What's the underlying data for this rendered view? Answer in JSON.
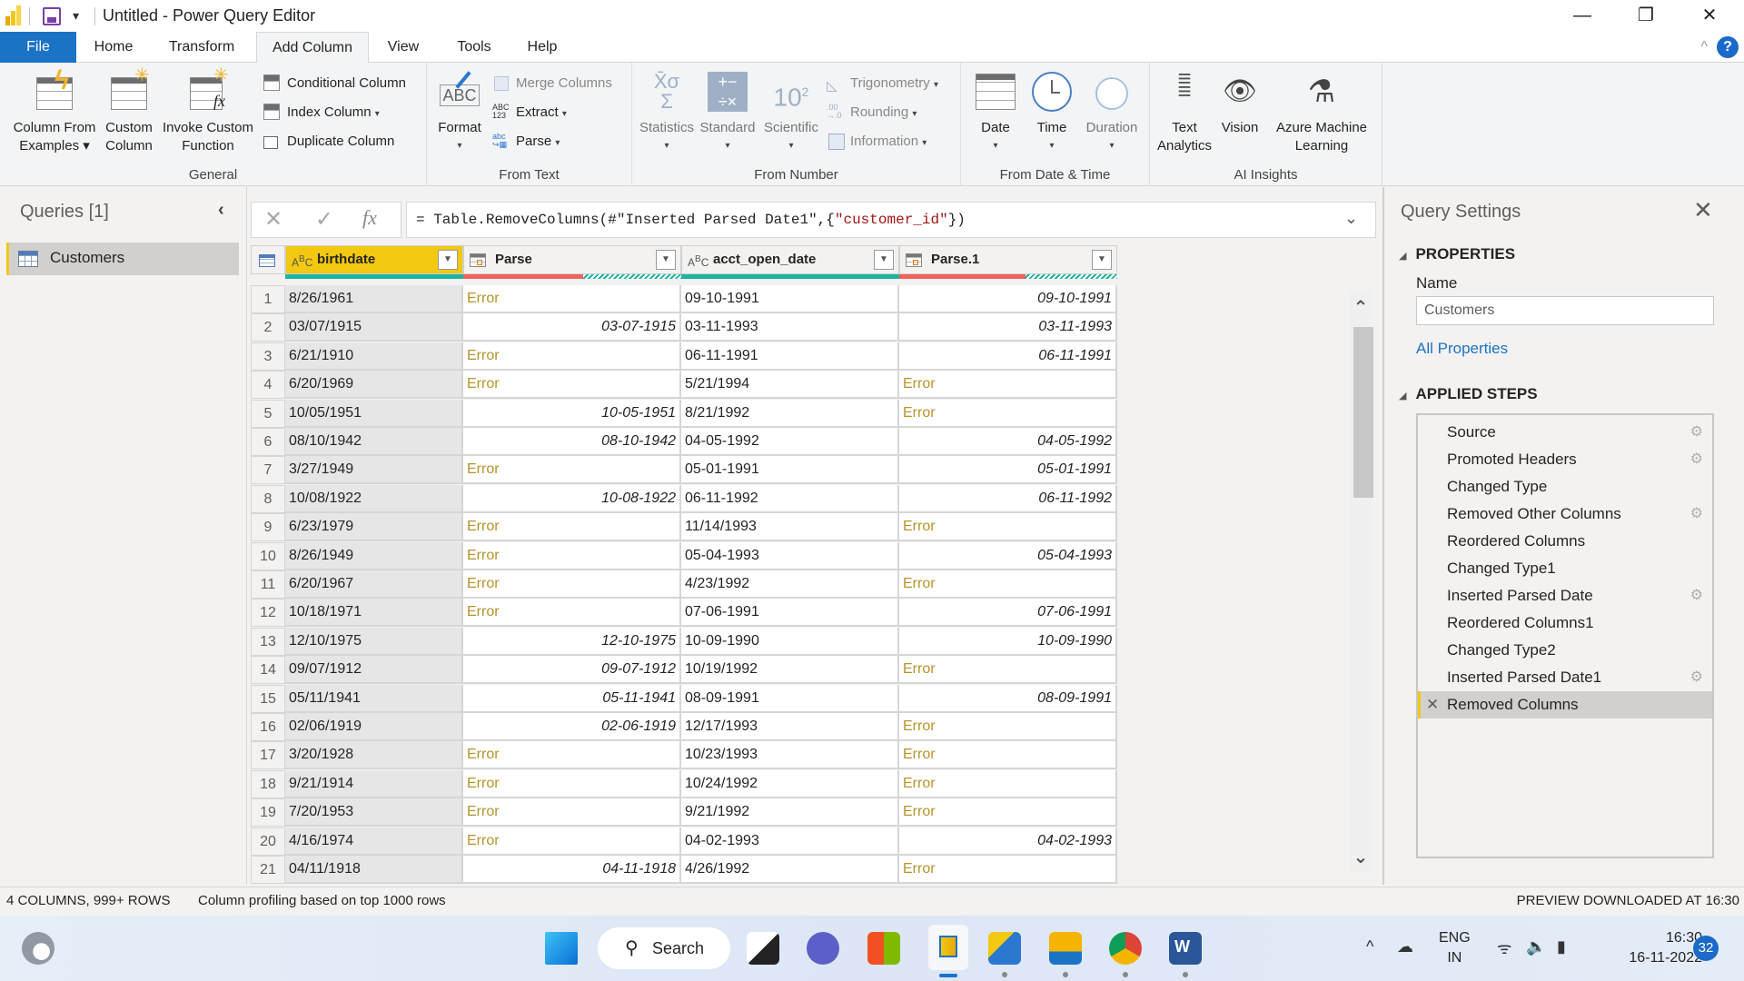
{
  "window": {
    "title": "Untitled - Power Query Editor",
    "qat_dropdown": "▾",
    "minimize": "—",
    "restore": "❐",
    "close": "✕"
  },
  "ribbon_tabs": [
    {
      "label": "File"
    },
    {
      "label": "Home"
    },
    {
      "label": "Transform"
    },
    {
      "label": "Add Column",
      "active": true
    },
    {
      "label": "View"
    },
    {
      "label": "Tools"
    },
    {
      "label": "Help"
    }
  ],
  "ribbon_controls": {
    "collapse": "^",
    "help": "?"
  },
  "ribbon": {
    "general": {
      "label": "General",
      "column_from_examples": [
        "Column From",
        "Examples ▾"
      ],
      "custom_column": [
        "Custom",
        "Column"
      ],
      "invoke_custom_function": [
        "Invoke Custom",
        "Function"
      ],
      "conditional_column": "Conditional Column",
      "index_column": "Index Column",
      "duplicate_column": "Duplicate Column"
    },
    "from_text": {
      "label": "From Text",
      "format": "Format",
      "merge_columns": "Merge Columns",
      "extract": "Extract",
      "parse": "Parse"
    },
    "from_number": {
      "label": "From Number",
      "statistics": "Statistics",
      "standard": "Standard",
      "scientific": "Scientific",
      "trigonometry": "Trigonometry",
      "rounding": "Rounding",
      "information": "Information"
    },
    "from_date_time": {
      "label": "From Date & Time",
      "date": "Date",
      "time": "Time",
      "duration": "Duration"
    },
    "ai_insights": {
      "label": "AI Insights",
      "text_analytics": [
        "Text",
        "Analytics"
      ],
      "vision": "Vision",
      "azure_ml": [
        "Azure Machine",
        "Learning"
      ]
    },
    "caret": "▾"
  },
  "queries": {
    "title": "Queries [1]",
    "collapse": "‹",
    "items": [
      {
        "label": "Customers",
        "selected": true
      }
    ]
  },
  "formula_bar": {
    "cancel": "✕",
    "commit": "✓",
    "fx": "fx",
    "prefix": "= Table.RemoveColumns(#\"Inserted Parsed Date1\",{",
    "string_literal": "\"customer_id\"",
    "suffix": "})",
    "expand": "⌄"
  },
  "grid": {
    "columns": [
      {
        "name": "birthdate",
        "type": "text",
        "type_icon": "ABC",
        "selected": true,
        "quality": {
          "valid": 1.0,
          "error": 0.0
        }
      },
      {
        "name": "Parse",
        "type": "date",
        "quality": {
          "valid": 0.0,
          "error": 0.55
        }
      },
      {
        "name": "acct_open_date",
        "type": "text",
        "type_icon": "ABC",
        "quality": {
          "valid": 1.0,
          "error": 0.0
        }
      },
      {
        "name": "Parse.1",
        "type": "date",
        "quality": {
          "valid": 0.0,
          "error": 0.58
        }
      }
    ],
    "rows": [
      [
        "8/26/1961",
        "Error",
        "09-10-1991",
        "09-10-1991"
      ],
      [
        "03/07/1915",
        "03-07-1915",
        "03-11-1993",
        "03-11-1993"
      ],
      [
        "6/21/1910",
        "Error",
        "06-11-1991",
        "06-11-1991"
      ],
      [
        "6/20/1969",
        "Error",
        "5/21/1994",
        "Error"
      ],
      [
        "10/05/1951",
        "10-05-1951",
        "8/21/1992",
        "Error"
      ],
      [
        "08/10/1942",
        "08-10-1942",
        "04-05-1992",
        "04-05-1992"
      ],
      [
        "3/27/1949",
        "Error",
        "05-01-1991",
        "05-01-1991"
      ],
      [
        "10/08/1922",
        "10-08-1922",
        "06-11-1992",
        "06-11-1992"
      ],
      [
        "6/23/1979",
        "Error",
        "11/14/1993",
        "Error"
      ],
      [
        "8/26/1949",
        "Error",
        "05-04-1993",
        "05-04-1993"
      ],
      [
        "6/20/1967",
        "Error",
        "4/23/1992",
        "Error"
      ],
      [
        "10/18/1971",
        "Error",
        "07-06-1991",
        "07-06-1991"
      ],
      [
        "12/10/1975",
        "12-10-1975",
        "10-09-1990",
        "10-09-1990"
      ],
      [
        "09/07/1912",
        "09-07-1912",
        "10/19/1992",
        "Error"
      ],
      [
        "05/11/1941",
        "05-11-1941",
        "08-09-1991",
        "08-09-1991"
      ],
      [
        "02/06/1919",
        "02-06-1919",
        "12/17/1993",
        "Error"
      ],
      [
        "3/20/1928",
        "Error",
        "10/23/1993",
        "Error"
      ],
      [
        "9/21/1914",
        "Error",
        "10/24/1992",
        "Error"
      ],
      [
        "7/20/1953",
        "Error",
        "9/21/1992",
        "Error"
      ],
      [
        "4/16/1974",
        "Error",
        "04-02-1993",
        "04-02-1993"
      ],
      [
        "04/11/1918",
        "04-11-1918",
        "4/26/1992",
        "Error"
      ]
    ],
    "scroll_up": "⌃",
    "scroll_down": "⌄"
  },
  "query_settings": {
    "title": "Query Settings",
    "close": "✕",
    "properties_header": "PROPERTIES",
    "name_label": "Name",
    "name_value": "Customers",
    "all_properties": "All Properties",
    "applied_steps_header": "APPLIED STEPS",
    "steps": [
      {
        "label": "Source",
        "gear": true
      },
      {
        "label": "Promoted Headers",
        "gear": true
      },
      {
        "label": "Changed Type",
        "gear": false
      },
      {
        "label": "Removed Other Columns",
        "gear": true
      },
      {
        "label": "Reordered Columns",
        "gear": false
      },
      {
        "label": "Changed Type1",
        "gear": false
      },
      {
        "label": "Inserted Parsed Date",
        "gear": true
      },
      {
        "label": "Reordered Columns1",
        "gear": false
      },
      {
        "label": "Changed Type2",
        "gear": false
      },
      {
        "label": "Inserted Parsed Date1",
        "gear": true
      },
      {
        "label": "Removed Columns",
        "gear": false,
        "active": true
      }
    ]
  },
  "status_bar": {
    "counts": "4 COLUMNS, 999+ ROWS",
    "profiling": "Column profiling based on top 1000 rows",
    "preview": "PREVIEW DOWNLOADED AT 16:30"
  },
  "taskbar": {
    "search_label": "Search",
    "apps": [
      "weather",
      "start",
      "search",
      "task-view",
      "teams",
      "store",
      "power-bi",
      "data-tool",
      "file-explorer",
      "chrome",
      "word"
    ],
    "tray": {
      "chevron": "^",
      "lang_top": "ENG",
      "lang_bottom": "IN",
      "time": "16:30",
      "date": "16-11-2022",
      "notifications": "32"
    }
  },
  "colors": {
    "accent_blue": "#1b73c6",
    "selected_yellow": "#f2c811",
    "error_text": "#b8932a",
    "quality_valid": "#1ab4a0",
    "quality_error": "#f5605a",
    "string_literal": "#a31515"
  }
}
